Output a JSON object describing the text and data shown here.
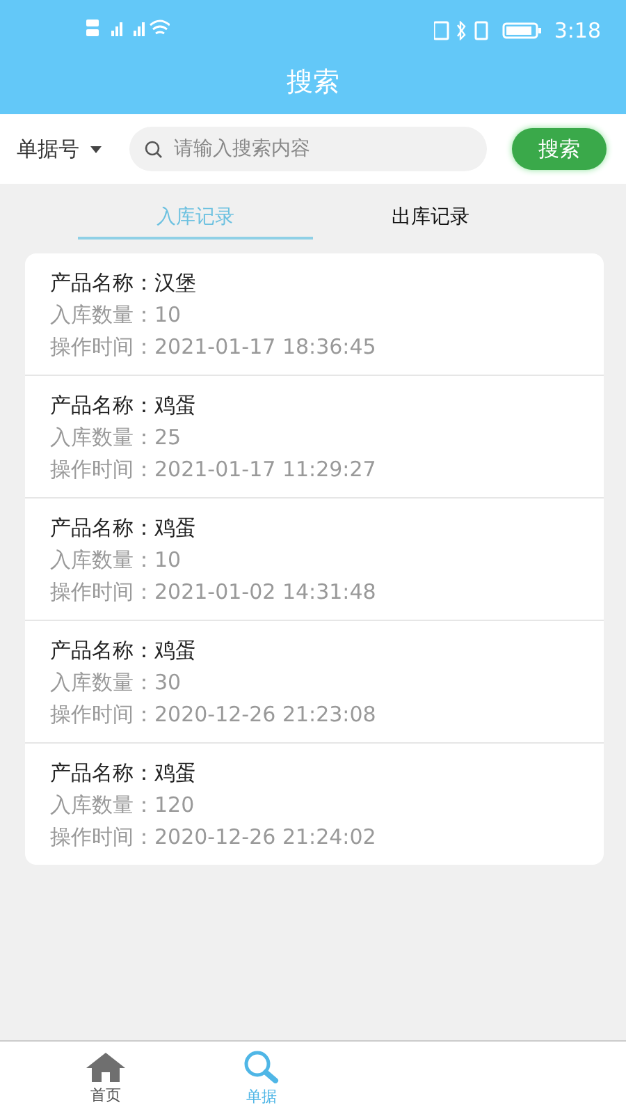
{
  "status_bar": {
    "time": "3:18"
  },
  "header": {
    "title": "搜索"
  },
  "search": {
    "filter": "单据号",
    "placeholder": "请输入搜索内容",
    "button": "搜索"
  },
  "tabs": [
    {
      "label": "入库记录",
      "selected": true
    },
    {
      "label": "出库记录",
      "selected": false
    }
  ],
  "records": [
    {
      "name_label": "产品名称：",
      "name": "汉堡",
      "quantity_label": "入库数量：",
      "quantity": "10",
      "time_label": "操作时间：",
      "time": "2021-01-17 18:36:45"
    },
    {
      "name_label": "产品名称：",
      "name": "鸡蛋",
      "quantity_label": "入库数量：",
      "quantity": "25",
      "time_label": "操作时间：",
      "time": "2021-01-17 11:29:27"
    },
    {
      "name_label": "产品名称：",
      "name": "鸡蛋",
      "quantity_label": "入库数量：",
      "quantity": "10",
      "time_label": "操作时间：",
      "time": "2021-01-02 14:31:48"
    },
    {
      "name_label": "产品名称：",
      "name": "鸡蛋",
      "quantity_label": "入库数量：",
      "quantity": "30",
      "time_label": "操作时间：",
      "time": "2020-12-26 21:23:08"
    },
    {
      "name_label": "产品名称：",
      "name": "鸡蛋",
      "quantity_label": "入库数量：",
      "quantity": "120",
      "time_label": "操作时间：",
      "time": "2020-12-26 21:24:02"
    }
  ],
  "bottom_nav": [
    {
      "kind": "home",
      "label": "首页",
      "selected": false
    },
    {
      "kind": "search",
      "label": "单据",
      "selected": true
    }
  ]
}
